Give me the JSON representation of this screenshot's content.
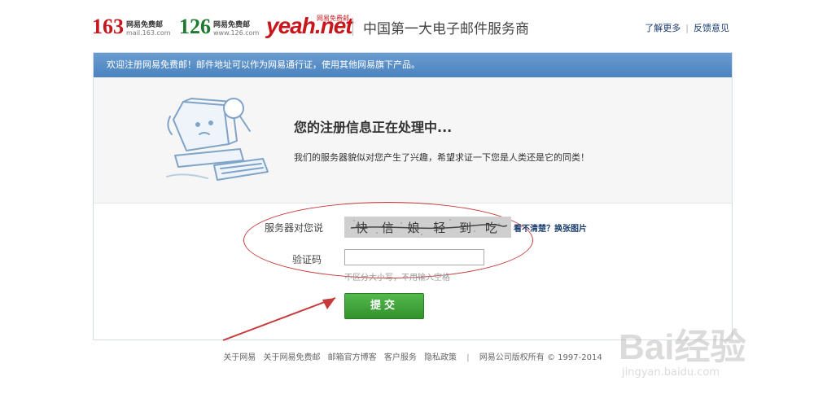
{
  "header": {
    "logo163": {
      "num": "163",
      "cn": "网易免费邮",
      "url": "mail.163.com"
    },
    "logo126": {
      "num": "126",
      "cn": "网易免费邮",
      "url": "www.126.com"
    },
    "logoyeah": {
      "text": "yeah.net",
      "cn": "网易免费邮"
    },
    "slogan": "中国第一大电子邮件服务商",
    "links": [
      "了解更多",
      "反馈意见"
    ]
  },
  "welcome": "欢迎注册网易免费邮！邮件地址可以作为网易通行证，使用其他网易旗下产品。",
  "processing": {
    "title": "您的注册信息正在处理中...",
    "desc": "我们的服务器貌似对您产生了兴趣，希望求证一下您是人类还是它的同类！"
  },
  "form": {
    "server_label": "服务器对您说",
    "captcha_text": "快 信 娘 轻 到 吃",
    "refresh_link": "看不清楚？换张图片",
    "code_label": "验证码",
    "code_value": "",
    "hint": "不区分大小写，不用输入空格",
    "submit": "提交"
  },
  "footer": {
    "links": [
      "关于网易",
      "关于网易免费邮",
      "邮箱官方博客",
      "客户服务",
      "隐私政策"
    ],
    "copyright": "网易公司版权所有 © 1997-2014"
  },
  "watermark": {
    "main": "Bai经验",
    "url": "jingyan.baidu.com"
  },
  "colors": {
    "accent_red": "#c8161d",
    "green": "#1d7a2f",
    "blue_bar": "#5b90c8",
    "submit_green": "#3fa33a"
  }
}
